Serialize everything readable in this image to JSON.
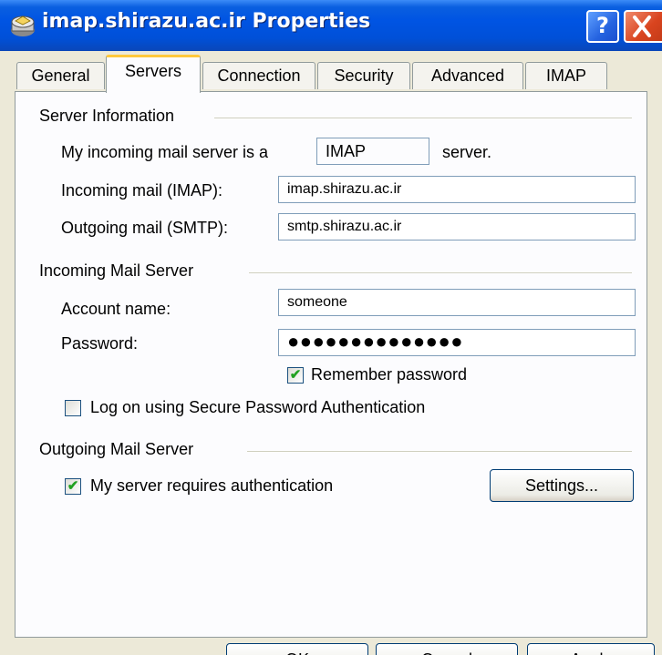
{
  "window": {
    "title": "imap.shirazu.ac.ir Properties",
    "help_label": "?",
    "close_label": "X"
  },
  "tabs": [
    {
      "label": "General",
      "active": false
    },
    {
      "label": "Servers",
      "active": true
    },
    {
      "label": "Connection",
      "active": false
    },
    {
      "label": "Security",
      "active": false
    },
    {
      "label": "Advanced",
      "active": false
    },
    {
      "label": "IMAP",
      "active": false
    }
  ],
  "server_info": {
    "group_label": "Server Information",
    "incoming_type_prefix": "My incoming mail server is a",
    "incoming_type_value": "IMAP",
    "incoming_type_suffix": "server.",
    "incoming_label": "Incoming mail (IMAP):",
    "incoming_value": "imap.shirazu.ac.ir",
    "outgoing_label": "Outgoing mail (SMTP):",
    "outgoing_value": "smtp.shirazu.ac.ir"
  },
  "incoming_server": {
    "group_label": "Incoming Mail Server",
    "account_label": "Account name:",
    "account_value": "someone",
    "password_label": "Password:",
    "password_value": "●●●●●●●●●●●●●●",
    "remember_label": "Remember password",
    "remember_checked": true,
    "spa_label": "Log on using Secure Password Authentication",
    "spa_checked": false
  },
  "outgoing_server": {
    "group_label": "Outgoing Mail Server",
    "auth_label": "My server requires authentication",
    "auth_checked": true,
    "settings_label": "Settings..."
  },
  "buttons": {
    "ok": "OK",
    "cancel": "Cancel",
    "apply": "Apply"
  },
  "colors": {
    "titlebar": "#0054e3",
    "active_tab_accent": "#ffc83c",
    "check": "#21a121",
    "dialog_bg": "#ece9d8"
  }
}
